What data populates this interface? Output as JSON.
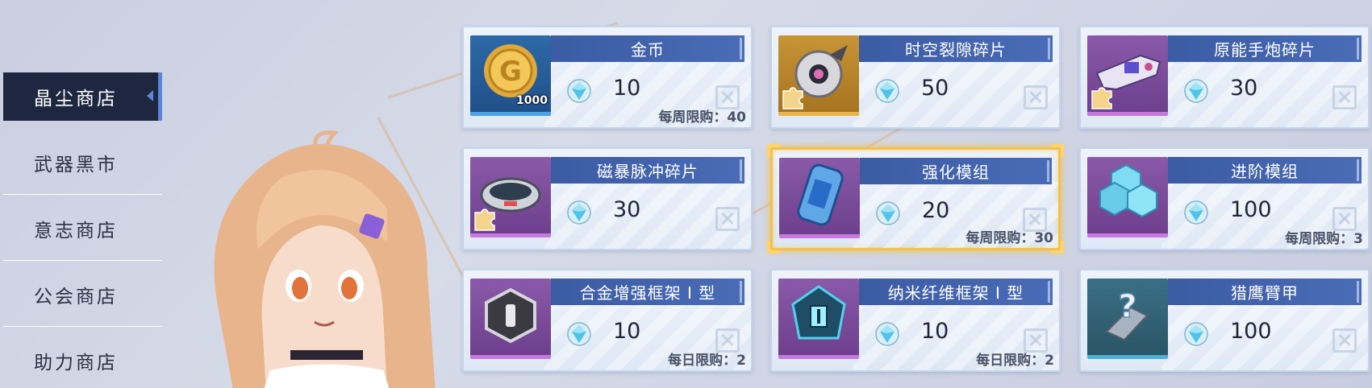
{
  "sidebar": {
    "items": [
      {
        "label": "晶尘商店",
        "active": true
      },
      {
        "label": "武器黑市",
        "active": false
      },
      {
        "label": "意志商店",
        "active": false
      },
      {
        "label": "公会商店",
        "active": false
      },
      {
        "label": "助力商店",
        "active": false
      }
    ]
  },
  "shop": {
    "currency_icon": "crystal-gem-icon",
    "items": [
      {
        "name": "金币",
        "price": "10",
        "limit": "每周限购：40",
        "icon": "gold-coin-icon",
        "icon_qty": "1000",
        "frame": "blue"
      },
      {
        "name": "时空裂隙碎片",
        "price": "50",
        "limit": "",
        "icon": "rift-drone-icon",
        "frame": "gold",
        "fragment": true
      },
      {
        "name": "原能手炮碎片",
        "price": "30",
        "limit": "",
        "icon": "hand-cannon-icon",
        "frame": "purple",
        "fragment": true
      },
      {
        "name": "磁暴脉冲碎片",
        "price": "30",
        "limit": "",
        "icon": "pulse-device-icon",
        "frame": "purple",
        "fragment": true
      },
      {
        "name": "强化模组",
        "price": "20",
        "limit": "每周限购：30",
        "icon": "enhance-module-icon",
        "frame": "purple",
        "selected": true
      },
      {
        "name": "进阶模组",
        "price": "100",
        "limit": "每周限购：3",
        "icon": "advanced-module-icon",
        "frame": "purple"
      },
      {
        "name": "合金增强框架 I 型",
        "price": "10",
        "limit": "每日限购：2",
        "icon": "alloy-frame-icon",
        "frame": "purple"
      },
      {
        "name": "纳米纤维框架 I 型",
        "price": "10",
        "limit": "每日限购：2",
        "icon": "nano-frame-icon",
        "frame": "purple"
      },
      {
        "name": "猎鹰臂甲",
        "price": "100",
        "limit": "",
        "icon": "falcon-armguard-icon",
        "frame": "teal",
        "unknown": true
      }
    ]
  },
  "colors": {
    "title_bar": "#3b5ba3",
    "active_tab": "#1d2740",
    "selected_border": "#f3c24a",
    "gem": "#4fc3e8"
  }
}
